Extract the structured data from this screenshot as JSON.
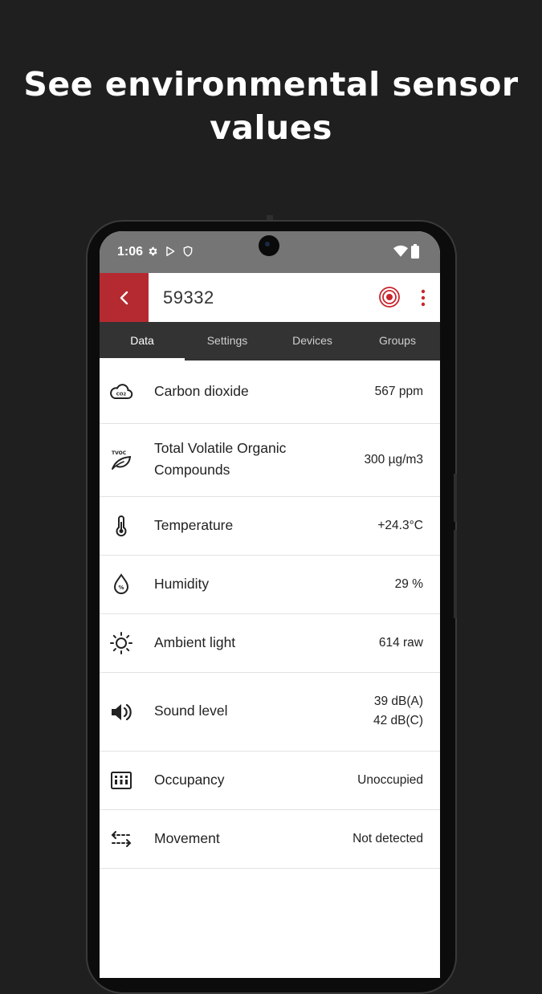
{
  "promo": {
    "line1": "See environmental sensor",
    "line2": "values"
  },
  "status_bar": {
    "time": "1:06",
    "icons": [
      "gear-icon",
      "play-store-icon",
      "shield-icon",
      "wifi-icon",
      "battery-icon"
    ]
  },
  "app_bar": {
    "title": "59332",
    "back_icon": "chevron-left-icon",
    "locate_icon": "target-icon",
    "menu_icon": "more-vert-icon",
    "accent_color": "#b52a30"
  },
  "tabs": [
    {
      "label": "Data",
      "active": true
    },
    {
      "label": "Settings",
      "active": false
    },
    {
      "label": "Devices",
      "active": false
    },
    {
      "label": "Groups",
      "active": false
    }
  ],
  "sensors": [
    {
      "icon": "co2-cloud-icon",
      "icon_text": "CO2",
      "label": "Carbon dioxide",
      "value": "567 ppm"
    },
    {
      "icon": "tvoc-leaf-icon",
      "icon_text": "TVOC",
      "label": "Total Volatile Organic Compounds",
      "value": "300 µg/m3"
    },
    {
      "icon": "thermometer-icon",
      "label": "Temperature",
      "value": "+24.3°C"
    },
    {
      "icon": "humidity-drop-icon",
      "icon_text": "%",
      "label": "Humidity",
      "value": "29 %"
    },
    {
      "icon": "sun-icon",
      "label": "Ambient light",
      "value": "614 raw"
    },
    {
      "icon": "speaker-icon",
      "label": "Sound level",
      "value": "39 dB(A)",
      "value2": "42 dB(C)"
    },
    {
      "icon": "occupancy-grid-icon",
      "label": "Occupancy",
      "value": "Unoccupied"
    },
    {
      "icon": "movement-arrows-icon",
      "label": "Movement",
      "value": "Not detected"
    }
  ]
}
